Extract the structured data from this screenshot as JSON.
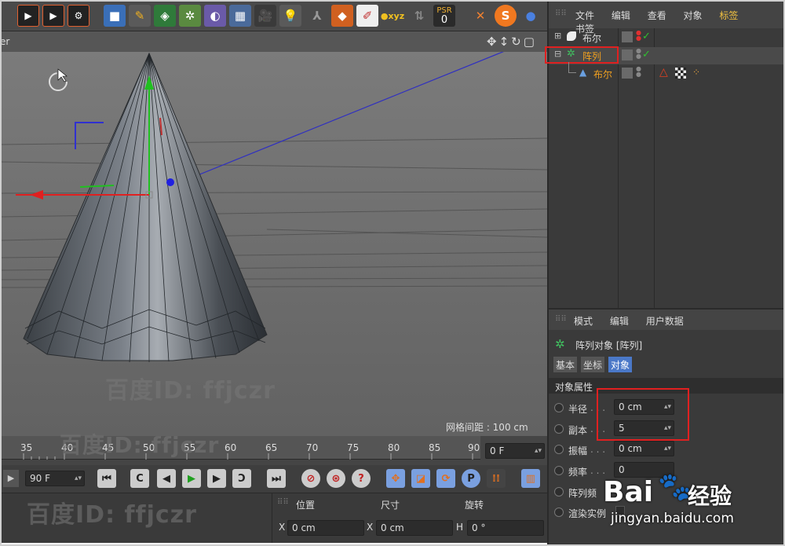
{
  "toolbar": {
    "psr_label": "PSR",
    "psr_value": "0"
  },
  "viewport": {
    "corner_label": "er",
    "grid_spacing": "网格间距 : 100 cm"
  },
  "obj_manager": {
    "menu": [
      "文件",
      "编辑",
      "查看",
      "对象",
      "标签",
      "书签"
    ],
    "rows": [
      {
        "label": "布尔"
      },
      {
        "label": "阵列"
      },
      {
        "label": "布尔"
      }
    ]
  },
  "attr_manager": {
    "menu": [
      "模式",
      "编辑",
      "用户数据"
    ],
    "object_title": "阵列对象 [阵列]",
    "tabs": [
      "基本",
      "坐标",
      "对象"
    ],
    "section_title": "对象属性",
    "props": [
      {
        "label": "半径",
        "dots": " . . .",
        "value": "0 cm"
      },
      {
        "label": "副本",
        "dots": " . . .",
        "value": "5"
      },
      {
        "label": "振幅",
        "dots": " . . .",
        "value": "0 cm"
      },
      {
        "label": "频率",
        "dots": " . . .",
        "value": "0"
      },
      {
        "label": "阵列频",
        "dots": "",
        "value": ""
      },
      {
        "label": "渲染实例",
        "dots": "",
        "value": ""
      }
    ]
  },
  "timeline": {
    "ticks": [
      "35",
      "40",
      "45",
      "50",
      "55",
      "60",
      "65",
      "70",
      "75",
      "80",
      "85",
      "90"
    ],
    "current_frame": "0 F",
    "end_frame": "90 F"
  },
  "coords": {
    "headers": [
      "位置",
      "尺寸",
      "旋转"
    ],
    "x_label": "X",
    "x_pos": "0 cm",
    "x_size": "0 cm",
    "h_label": "H",
    "h_rot": "0 °"
  },
  "watermarks": {
    "baidu_id": "百度ID: ffjczr",
    "baidu_logo": "Bai",
    "baidu_logo2": "经验",
    "baidu_url": "jingyan.baidu.com"
  },
  "colors": {
    "highlight_red": "#e02020",
    "selected_orange": "#f0a020",
    "accent_blue": "#4a78c8"
  }
}
